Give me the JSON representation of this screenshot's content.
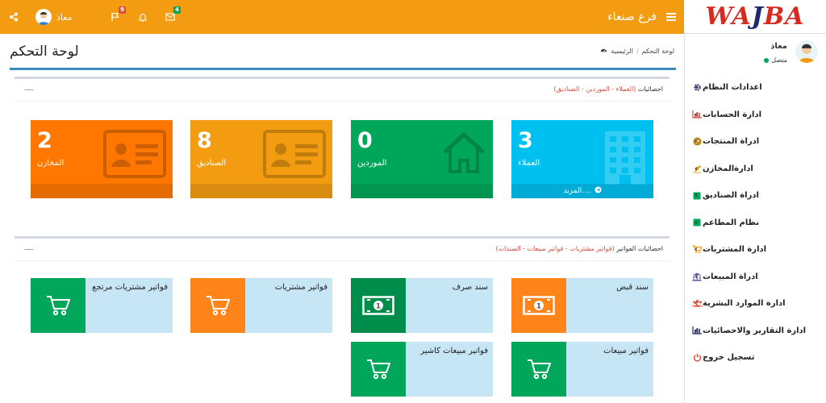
{
  "topbar": {
    "brand_w": "WA",
    "brand_j": "J",
    "brand_rest": "BA",
    "branch": "فرع صنعاء",
    "user": "معاذ",
    "badges": {
      "messages": "4",
      "notifications": "",
      "tasks": "9"
    }
  },
  "sidebar": {
    "user_name": "معاذ",
    "user_status": "متصل",
    "items": [
      {
        "label": "اعدادات النظام",
        "icon": "gear-icon",
        "color": "#1d2a6e"
      },
      {
        "label": "ادارة الحسابات",
        "icon": "bar-chart-icon",
        "color": "#dd4b39"
      },
      {
        "label": "ادراة المنتجات",
        "icon": "product-icon",
        "color": "#c08a1a"
      },
      {
        "label": "ادارةالمخازن",
        "icon": "edit-icon",
        "color": "#f39c12"
      },
      {
        "label": "ادراة الصناديق",
        "icon": "square-icon",
        "color": "#00a65a"
      },
      {
        "label": "نظام المطاعم",
        "icon": "square-icon",
        "color": "#00a65a"
      },
      {
        "label": "ادارة المشتريات",
        "icon": "cart-icon",
        "color": "#f39c12"
      },
      {
        "label": "ادراة المبيعات",
        "icon": "bank-icon",
        "color": "#605ca8"
      },
      {
        "label": "ادارة الموارد البشرية",
        "icon": "users-icon",
        "color": "#f56954"
      },
      {
        "label": "ادارة التقارير والاحصائيات",
        "icon": "bar-chart-icon",
        "color": "#1d2a6e"
      },
      {
        "label": "تسجيل خروج",
        "icon": "power-icon",
        "color": "#dd4b39"
      }
    ]
  },
  "page": {
    "title": "لوحة التحكم",
    "breadcrumb_home": "الرئيسية",
    "breadcrumb_current": "لوحة التحكم"
  },
  "box1": {
    "title": "احصائيات",
    "title_detail": "(العملاء - الموردين - الصناديق)",
    "stats": [
      {
        "value": "3",
        "label": "العملاء",
        "color": "#00c0ef",
        "icon": "building-icon",
        "footer": "المزيد...."
      },
      {
        "value": "0",
        "label": "الموردين",
        "color": "#00a65a",
        "icon": "home-icon"
      },
      {
        "value": "8",
        "label": "الصناديق",
        "color": "#f39c12",
        "icon": "id-card-icon"
      },
      {
        "value": "2",
        "label": "المخازن",
        "color": "#ff7701",
        "icon": "id-card-icon"
      }
    ]
  },
  "box2": {
    "title": "احصائيات الفواتير",
    "title_detail": "(فواتير مشتريات - فواتير مبيعات - السندات)",
    "items": [
      {
        "label": "سند قبض",
        "color": "#ff851b",
        "icon": "money-icon"
      },
      {
        "label": "سند صرف",
        "color": "#008d4c",
        "icon": "money-icon"
      },
      {
        "label": "فواتير مشتريات",
        "color": "#ff851b",
        "icon": "cart-icon"
      },
      {
        "label": "فواتير مشتريات مرتجع",
        "color": "#00a65a",
        "icon": "cart-icon"
      },
      {
        "label": "فواتير مبيعات",
        "color": "#00a65a",
        "icon": "cart-icon"
      },
      {
        "label": "فواتير مبيعات كاشير",
        "color": "#00a65a",
        "icon": "cart-icon"
      }
    ]
  }
}
